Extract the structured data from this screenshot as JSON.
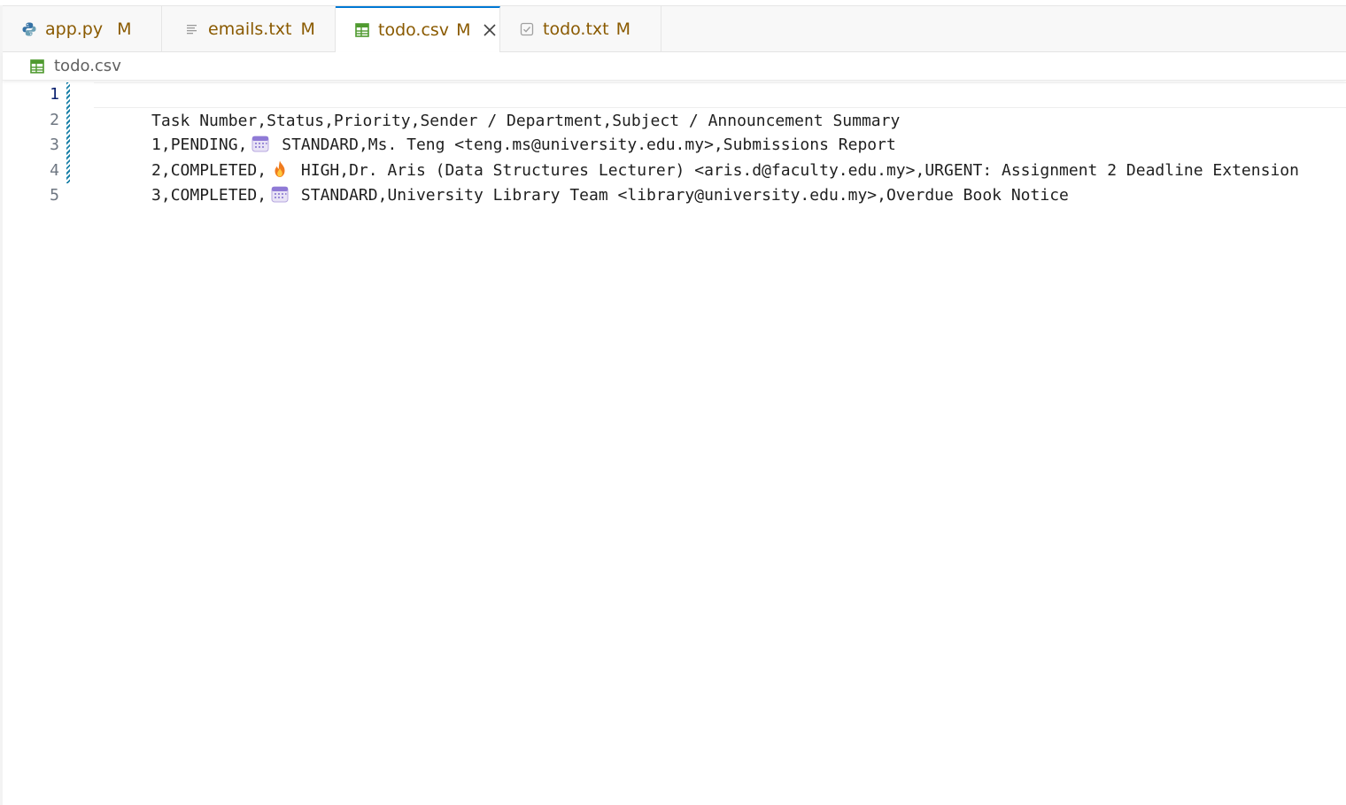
{
  "tabs": [
    {
      "name": "app.py",
      "modified": "M",
      "icon": "python-icon"
    },
    {
      "name": "emails.txt",
      "modified": "M",
      "icon": "text-lines-icon"
    },
    {
      "name": "todo.csv",
      "modified": "M",
      "icon": "csv-table-icon",
      "active": true
    },
    {
      "name": "todo.txt",
      "modified": "M",
      "icon": "checkbox-icon"
    }
  ],
  "breadcrumb": {
    "file": "todo.csv",
    "icon": "csv-table-icon"
  },
  "editor": {
    "line_numbers": [
      "1",
      "2",
      "3",
      "4",
      "5"
    ],
    "lines": [
      {
        "text": "Task Number,Status,Priority,Sender / Department,Subject / Announcement Summary"
      },
      {
        "before": "1,PENDING,",
        "emoji": "calendar-icon",
        "after": " STANDARD,Ms. Teng <teng.ms@university.edu.my>,Submissions Report"
      },
      {
        "before": "2,COMPLETED,",
        "emoji": "fire-icon",
        "after": " HIGH,Dr. Aris (Data Structures Lecturer) <aris.d@faculty.edu.my>,URGENT: Assignment 2 Deadline Extension"
      },
      {
        "before": "3,COMPLETED,",
        "emoji": "calendar-icon",
        "after": " STANDARD,University Library Team <library@university.edu.my>,Overdue Book Notice"
      },
      {
        "text": ""
      }
    ]
  },
  "colors": {
    "accent": "#0078d4",
    "modified": "#8a5a00",
    "gutter_modified": "#1b81a8",
    "csv_icon": "#4f9a2f",
    "python_icon": "#3572a5"
  }
}
